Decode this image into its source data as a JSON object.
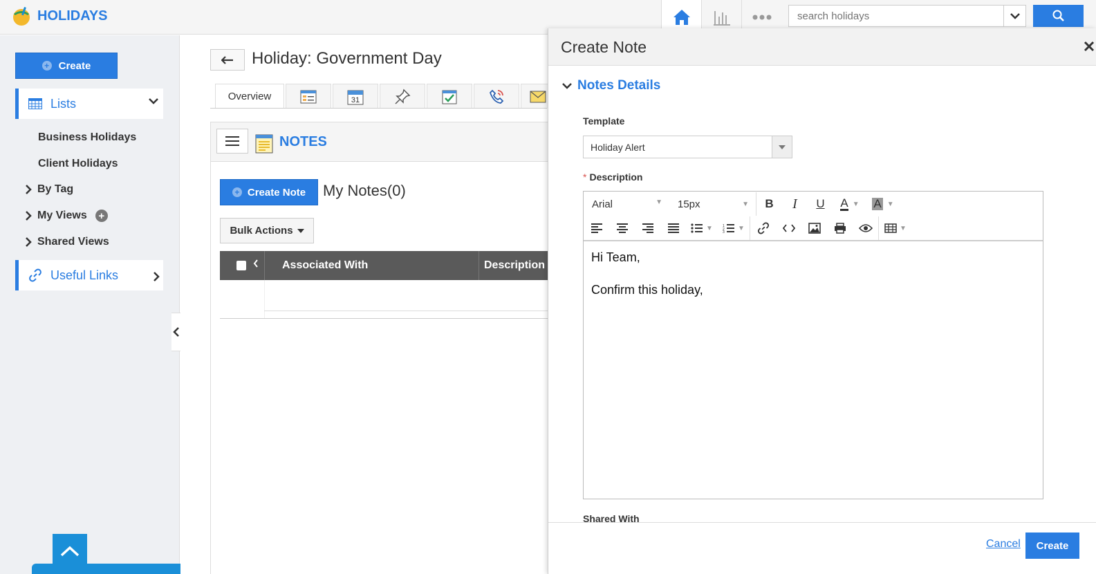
{
  "app": {
    "title": "HOLIDAYS"
  },
  "search": {
    "placeholder": "search holidays"
  },
  "sidebar": {
    "create_label": "Create",
    "lists_label": "Lists",
    "items": [
      {
        "label": "Business Holidays"
      },
      {
        "label": "Client Holidays"
      }
    ],
    "by_tag": "By Tag",
    "my_views": "My Views",
    "shared_views": "Shared Views",
    "useful_links": "Useful Links"
  },
  "main": {
    "title": "Holiday: Government Day",
    "tabs": [
      {
        "label": "Overview"
      }
    ],
    "notes_title": "NOTES",
    "create_note_label": "Create Note",
    "my_notes": "My Notes(0)",
    "bulk_actions": "Bulk Actions",
    "columns": [
      "Associated With",
      "Description"
    ]
  },
  "modal": {
    "title": "Create Note",
    "section": "Notes Details",
    "template_label": "Template",
    "template_value": "Holiday Alert",
    "description_label": "Description",
    "font": "Arial",
    "font_size": "15px",
    "body_lines": [
      "Hi Team,",
      "Confirm this holiday,"
    ],
    "shared_with_label": "Shared With",
    "cancel_label": "Cancel",
    "create_label": "Create"
  },
  "colors": {
    "accent": "#2a7de1",
    "scroll": "#1a8fd8"
  }
}
